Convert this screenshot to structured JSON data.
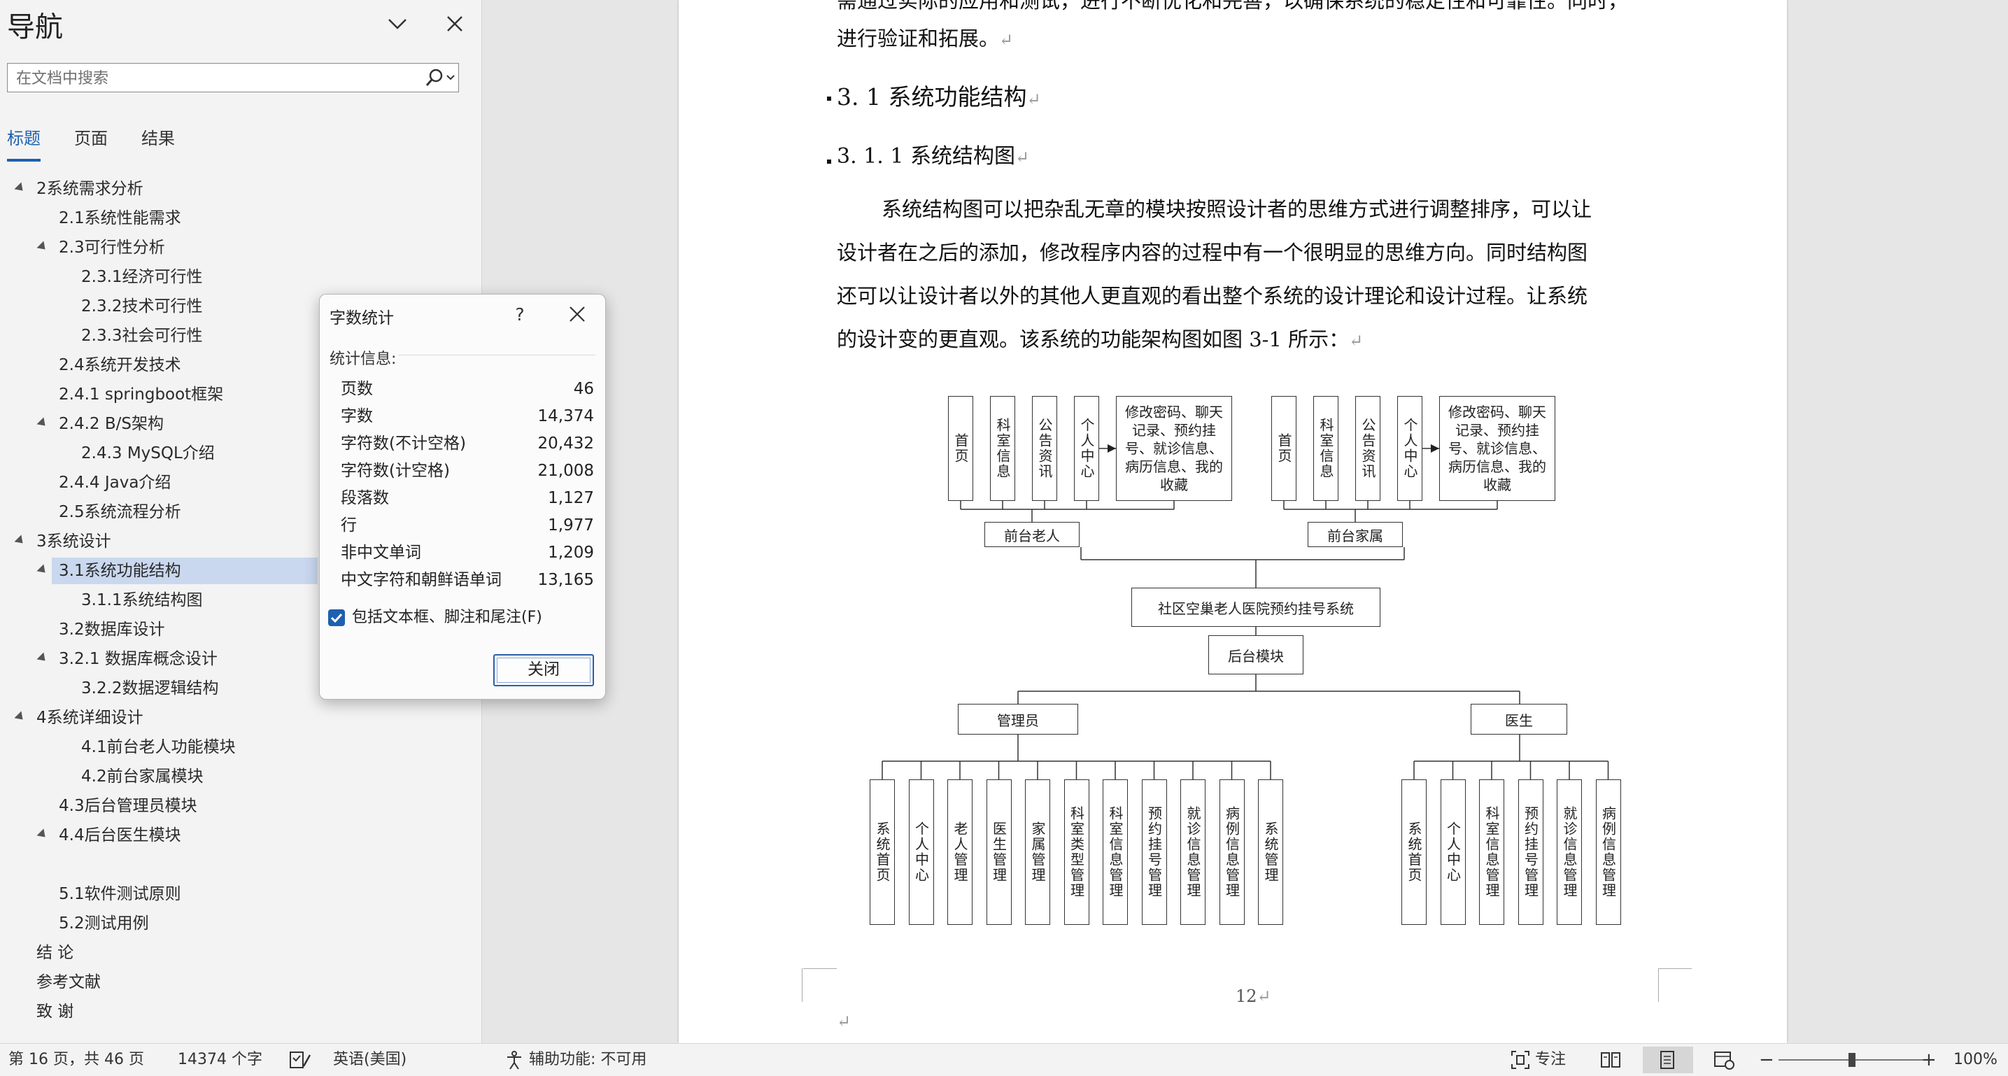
{
  "nav": {
    "title": "导航",
    "search_placeholder": "在文档中搜索",
    "tabs": [
      "标题",
      "页面",
      "结果"
    ],
    "items": [
      {
        "label": "2系统需求分析",
        "level": 1,
        "expanded": true
      },
      {
        "label": "2.1系统性能需求",
        "level": 2
      },
      {
        "label": "2.3可行性分析",
        "level": 2,
        "expanded": true
      },
      {
        "label": "2.3.1经济可行性",
        "level": 3
      },
      {
        "label": "2.3.2技术可行性",
        "level": 3
      },
      {
        "label": "2.3.3社会可行性",
        "level": 3
      },
      {
        "label": "2.4系统开发技术",
        "level": 2
      },
      {
        "label": "2.4.1 springboot框架",
        "level": 2
      },
      {
        "label": "2.4.2 B/S架构",
        "level": 2,
        "expanded": true
      },
      {
        "label": "2.4.3 MySQL介绍",
        "level": 3
      },
      {
        "label": "2.4.4 Java介绍",
        "level": 2
      },
      {
        "label": "2.5系统流程分析",
        "level": 2
      },
      {
        "label": "3系统设计",
        "level": 1,
        "expanded": true
      },
      {
        "label": "3.1系统功能结构",
        "level": 2,
        "expanded": true,
        "selected": true
      },
      {
        "label": "3.1.1系统结构图",
        "level": 3
      },
      {
        "label": "3.2数据库设计",
        "level": 2
      },
      {
        "label": "3.2.1 数据库概念设计",
        "level": 2,
        "expanded": true
      },
      {
        "label": "3.2.2数据逻辑结构",
        "level": 3
      },
      {
        "label": "4系统详细设计",
        "level": 1,
        "expanded": true
      },
      {
        "label": "4.1前台老人功能模块",
        "level": 3
      },
      {
        "label": "4.2前台家属模块",
        "level": 3
      },
      {
        "label": "4.3后台管理员模块",
        "level": 2
      },
      {
        "label": "4.4后台医生模块",
        "level": 2,
        "expanded": true
      },
      {
        "label": "",
        "level": 2
      },
      {
        "label": "5.1软件测试原则",
        "level": 2
      },
      {
        "label": "5.2测试用例",
        "level": 2
      },
      {
        "label": "结  论",
        "level": 1
      },
      {
        "label": "参考文献",
        "level": 1
      },
      {
        "label": "致  谢",
        "level": 1
      }
    ]
  },
  "dialog": {
    "title": "字数统计",
    "help": "?",
    "stats_label": "统计信息:",
    "stats": [
      {
        "name": "页数",
        "value": "46"
      },
      {
        "name": "字数",
        "value": "14,374"
      },
      {
        "name": "字符数(不计空格)",
        "value": "20,432"
      },
      {
        "name": "字符数(计空格)",
        "value": "21,008"
      },
      {
        "name": "段落数",
        "value": "1,127"
      },
      {
        "name": "行",
        "value": "1,977"
      },
      {
        "name": "非中文单词",
        "value": "1,209"
      },
      {
        "name": "中文字符和朝鲜语单词",
        "value": "13,165"
      }
    ],
    "include_label": "包括文本框、脚注和尾注(F)",
    "include_checked": true,
    "close_label": "关闭"
  },
  "document": {
    "top_line1": "需通过实际的应用和测试，进行不断优化和完善，以确保系统的稳定性和可靠性。同时，",
    "top_line2": "进行验证和拓展。",
    "heading2": "3. 1 系统功能结构",
    "heading3": "3. 1. 1 系统结构图",
    "body": [
      "系统结构图可以把杂乱无章的模块按照设计者的思维方式进行调整排序，可以让",
      "设计者在之后的添加，修改程序内容的过程中有一个很明显的思维方向。同时结构图",
      "还可以让设计者以外的其他人更直观的看出整个系统的设计理论和设计过程。让系统",
      "的设计变的更直观。该系统的功能架构图如图 3-1 所示："
    ],
    "page_number": "12",
    "para_mark": "↵"
  },
  "diagram": {
    "elderly_modules": [
      "首页",
      "科室信息",
      "公告资讯",
      "个人中心"
    ],
    "elderly_personal": "修改密码、聊天记录、预约挂号、就诊信息、病历信息、我的收藏",
    "family_modules": [
      "首页",
      "科室信息",
      "公告资讯",
      "个人中心"
    ],
    "family_personal": "修改密码、聊天记录、预约挂号、就诊信息、病历信息、我的收藏",
    "elderly_label": "前台老人",
    "family_label": "前台家属",
    "system_label": "社区空巢老人医院预约挂号系统",
    "backend_label": "后台模块",
    "admin_label": "管理员",
    "doctor_label": "医生",
    "admin_modules": [
      "系统首页",
      "个人中心",
      "老人管理",
      "医生管理",
      "家属管理",
      "科室类型管理",
      "科室信息管理",
      "预约挂号管理",
      "就诊信息管理",
      "病例信息管理",
      "系统管理"
    ],
    "doctor_modules": [
      "系统首页",
      "个人中心",
      "科室信息管理",
      "预约挂号管理",
      "就诊信息管理",
      "病例信息管理"
    ]
  },
  "statusbar": {
    "page_info": "第 16 页，共 46 页",
    "word_count": "14374 个字",
    "language": "英语(美国)",
    "accessibility": "辅助功能: 不可用",
    "focus": "专注",
    "zoom": "100%",
    "zoom_level": 1.0
  }
}
